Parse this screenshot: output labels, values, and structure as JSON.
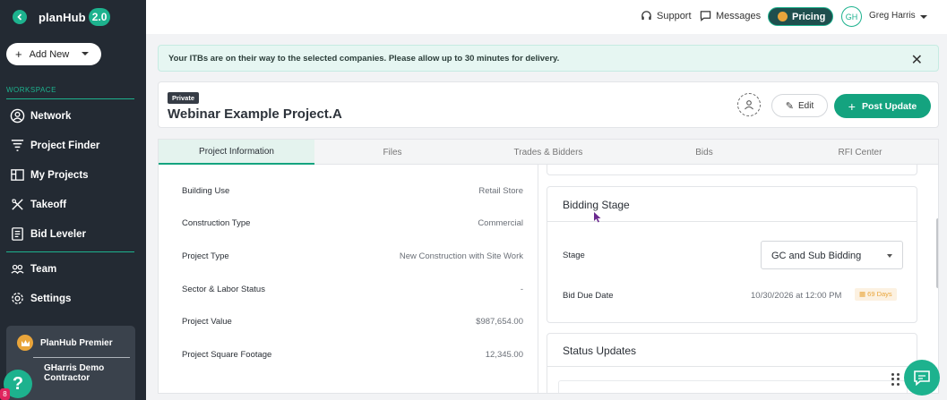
{
  "sidebar": {
    "logo": "planHub",
    "logo_badge": "2.0",
    "add_new": "Add New",
    "workspace_label": "WORKSPACE",
    "items": [
      {
        "label": "Network",
        "icon": "user-circle-icon"
      },
      {
        "label": "Project Finder",
        "icon": "filter-icon"
      },
      {
        "label": "My Projects",
        "icon": "projects-icon"
      },
      {
        "label": "Takeoff",
        "icon": "takeoff-icon"
      },
      {
        "label": "Bid Leveler",
        "icon": "bid-leveler-icon"
      },
      {
        "label": "Team",
        "icon": "team-icon"
      },
      {
        "label": "Settings",
        "icon": "gear-icon"
      }
    ],
    "premier_label": "PlanHub Premier",
    "company_name": "GHarris Demo Contractor",
    "help_badge": "8"
  },
  "topbar": {
    "support": "Support",
    "messages": "Messages",
    "pricing": "Pricing",
    "avatar_initials": "GH",
    "user_name": "Greg Harris"
  },
  "alert": {
    "text": "Your ITBs are on their way to the selected companies. Please allow up to 30 minutes for delivery.",
    "close": "✕"
  },
  "project": {
    "badge": "Private",
    "title": "Webinar Example Project.A",
    "edit": "Edit",
    "post_update": "Post Update"
  },
  "tabs": [
    "Project Information",
    "Files",
    "Trades & Bidders",
    "Bids",
    "RFI Center"
  ],
  "info_rows": [
    {
      "label": "Building Use",
      "value": "Retail Store"
    },
    {
      "label": "Construction Type",
      "value": "Commercial"
    },
    {
      "label": "Project Type",
      "value": "New Construction with Site Work"
    },
    {
      "label": "Sector & Labor Status",
      "value": "-"
    },
    {
      "label": "Project Value",
      "value": "$987,654.00"
    },
    {
      "label": "Project Square Footage",
      "value": "12,345.00"
    }
  ],
  "bidding": {
    "title": "Bidding Stage",
    "stage_label": "Stage",
    "stage_value": "GC and Sub Bidding",
    "due_label": "Bid Due Date",
    "due_value": "10/30/2026 at 12:00 PM",
    "days_badge": "69 Days"
  },
  "status_updates": {
    "title": "Status Updates"
  },
  "colors": {
    "sidebar_bg": "#232a33",
    "accent": "#1db28e",
    "primary_button": "#14a37f",
    "alert_bg": "#e6f6f2"
  }
}
